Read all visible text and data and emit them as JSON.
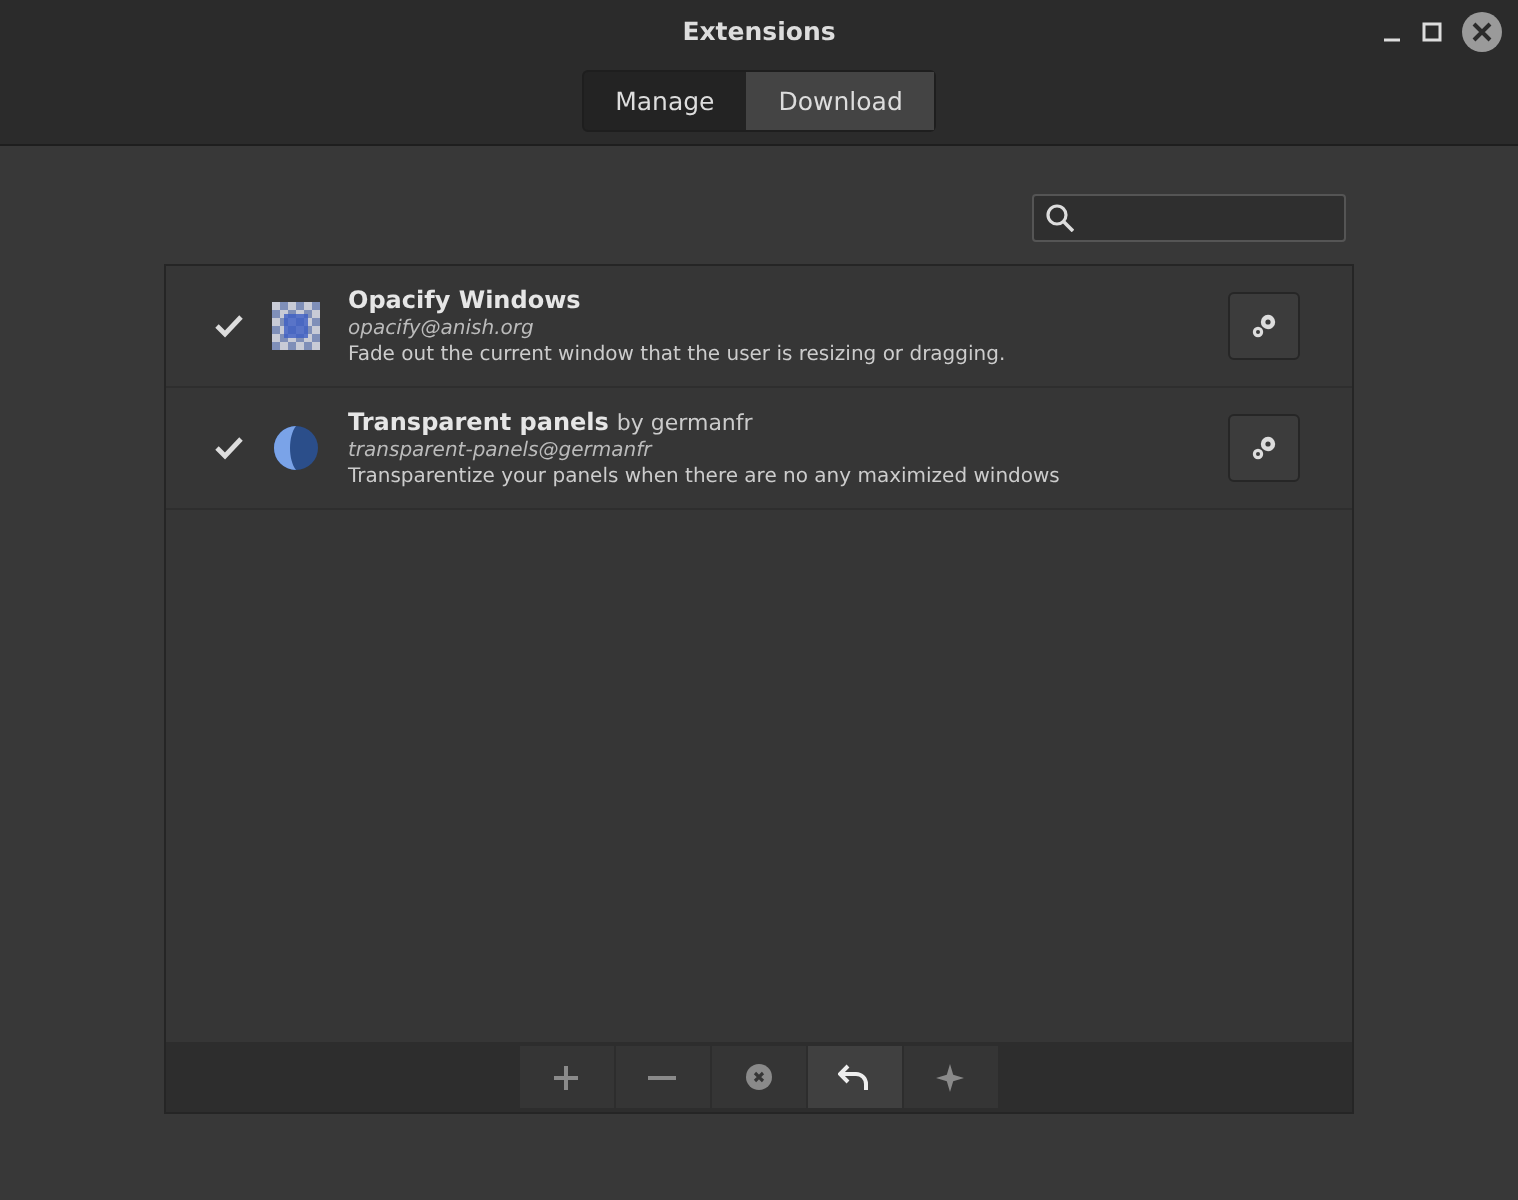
{
  "window": {
    "title": "Extensions"
  },
  "tabs": [
    {
      "label": "Manage",
      "selected": false
    },
    {
      "label": "Download",
      "selected": true
    }
  ],
  "extensions": [
    {
      "name": "Opacify Windows",
      "uuid": "opacify@anish.org",
      "description": "Fade out the current window that the user is resizing or dragging.",
      "checked": true
    },
    {
      "name": "Transparent panels",
      "author": "by germanfr",
      "uuid": "transparent-panels@germanfr",
      "description": "Transparentize your panels when there are no any maximized windows",
      "checked": true
    }
  ],
  "toolbar": [
    {
      "kind": "add",
      "disabled": true
    },
    {
      "kind": "remove",
      "disabled": true
    },
    {
      "kind": "clear",
      "disabled": true
    },
    {
      "kind": "undo",
      "disabled": false
    },
    {
      "kind": "star",
      "disabled": true
    }
  ]
}
